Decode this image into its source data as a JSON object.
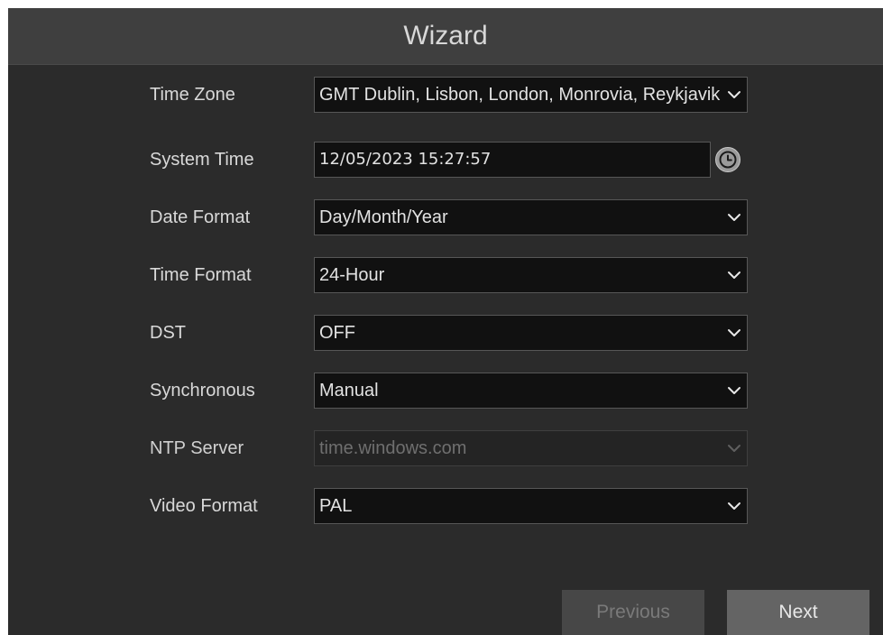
{
  "window": {
    "title": "Wizard"
  },
  "form": {
    "time_zone": {
      "label": "Time Zone",
      "value": "GMT Dublin, Lisbon, London, Monrovia, Reykjavik"
    },
    "system_time": {
      "label": "System Time",
      "value": "12/05/2023 15:27:57"
    },
    "date_format": {
      "label": "Date Format",
      "value": "Day/Month/Year"
    },
    "time_format": {
      "label": "Time Format",
      "value": "24-Hour"
    },
    "dst": {
      "label": "DST",
      "value": "OFF"
    },
    "synchronous": {
      "label": "Synchronous",
      "value": "Manual"
    },
    "ntp_server": {
      "label": "NTP Server",
      "value": "time.windows.com",
      "disabled": true
    },
    "video_format": {
      "label": "Video Format",
      "value": "PAL"
    }
  },
  "buttons": {
    "previous_label": "Previous",
    "next_label": "Next"
  },
  "icons": {
    "dropdown": "chevron-down-icon",
    "clock": "clock-icon"
  },
  "colors": {
    "window_background": "#2b2b2b",
    "title_bar": "#3f3f3f",
    "field_background": "#111111",
    "disabled_field_background": "#242424",
    "button_next": "#646464",
    "button_previous": "#474747"
  }
}
